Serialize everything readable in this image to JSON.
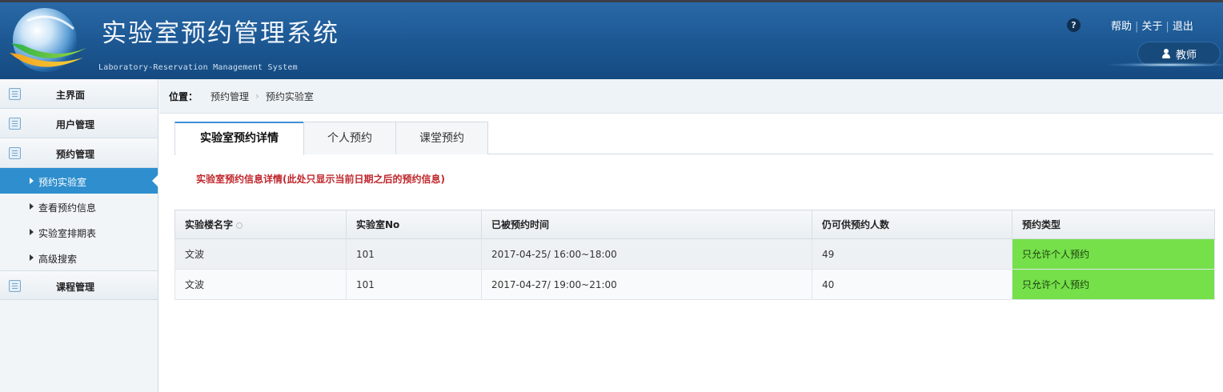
{
  "header": {
    "title": "实验室预约管理系统",
    "subtitle": "Laboratory-Reservation Management System",
    "help_icon": "?",
    "links": {
      "help": "帮助",
      "about": "关于",
      "logout": "退出"
    },
    "role": "教师"
  },
  "sidebar": {
    "sections": [
      {
        "label": "主界面",
        "icon": "list-icon"
      },
      {
        "label": "用户管理",
        "icon": "list-icon"
      },
      {
        "label": "预约管理",
        "icon": "list-icon"
      }
    ],
    "sub_items": [
      {
        "label": "预约实验室",
        "active": true
      },
      {
        "label": "查看预约信息",
        "active": false
      },
      {
        "label": "实验室排期表",
        "active": false
      },
      {
        "label": "高级搜索",
        "active": false
      }
    ],
    "bottom_section": {
      "label": "课程管理",
      "icon": "list-icon"
    }
  },
  "breadcrumb": {
    "label": "位置：",
    "items": [
      "预约管理",
      "预约实验室"
    ],
    "separator": "›"
  },
  "tabs": [
    {
      "label": "实验室预约详情",
      "active": true
    },
    {
      "label": "个人预约",
      "active": false
    },
    {
      "label": "课堂预约",
      "active": false
    }
  ],
  "notice": "实验室预约信息详情(此处只显示当前日期之后的预约信息)",
  "table": {
    "columns": [
      "实验楼名字",
      "实验室No",
      "已被预约时间",
      "仍可供预约人数",
      "预约类型"
    ],
    "rows": [
      [
        "文波",
        "101",
        "2017-04-25/ 16:00~18:00",
        "49",
        "只允许个人预约"
      ],
      [
        "文波",
        "101",
        "2017-04-27/ 19:00~21:00",
        "40",
        "只允许个人预约"
      ]
    ]
  },
  "colors": {
    "header_blue": "#1e5a96",
    "active_nav": "#2f8fce",
    "notice_red": "#c0272d",
    "type_green": "#75e04a"
  }
}
